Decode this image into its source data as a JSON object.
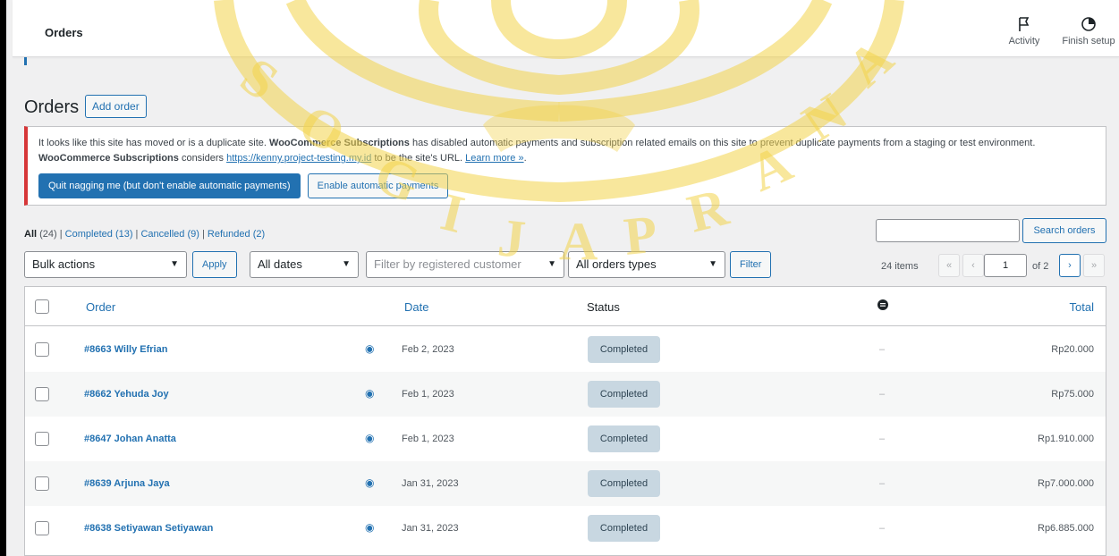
{
  "topbar": {
    "title": "Orders",
    "activity_label": "Activity",
    "activity_icon": "flag-icon",
    "finish_label": "Finish setup",
    "finish_icon": "progress-circle-icon"
  },
  "page": {
    "title": "Orders",
    "add_order_label": "Add order"
  },
  "notice": {
    "text_1": "It looks like this site has moved or is a duplicate site. ",
    "brand_1": "WooCommerce Subscriptions",
    "text_2": " has disabled automatic payments and subscription related emails on this site to prevent duplicate payments from a staging or test environment. ",
    "brand_2": "WooCommerce Subscriptions",
    "text_3": " considers ",
    "url": "https://kenny.project-testing.my.id",
    "text_4": " to be the site's URL. ",
    "learn_more": "Learn more »",
    "text_5": ".",
    "quit_button": "Quit nagging me (but don't enable automatic payments)",
    "enable_button": "Enable automatic payments"
  },
  "filters_nav": {
    "all_label": "All",
    "all_count": "(24)",
    "completed_label": "Completed",
    "completed_count": "(13)",
    "cancelled_label": "Cancelled",
    "cancelled_count": "(9)",
    "refunded_label": "Refunded",
    "refunded_count": "(2)",
    "separator": " | "
  },
  "search": {
    "value": "",
    "button": "Search orders"
  },
  "toolbar": {
    "bulk_actions": "Bulk actions",
    "apply": "Apply",
    "dates": "All dates",
    "customer_placeholder": "Filter by registered customer",
    "order_types": "All orders types",
    "filter": "Filter"
  },
  "pagination": {
    "items": "24 items",
    "first": "«",
    "prev": "‹",
    "current_page": "1",
    "of_total": "of 2",
    "next": "›",
    "last": "»"
  },
  "table": {
    "columns": {
      "order": "Order",
      "date": "Date",
      "status": "Status",
      "origin_icon": "comment-icon",
      "total": "Total"
    },
    "rows": [
      {
        "order": "#8663 Willy Efrian",
        "date": "Feb 2, 2023",
        "status": "Completed",
        "origin": "–",
        "total": "Rp20.000"
      },
      {
        "order": "#8662 Yehuda Joy",
        "date": "Feb 1, 2023",
        "status": "Completed",
        "origin": "–",
        "total": "Rp75.000"
      },
      {
        "order": "#8647 Johan Anatta",
        "date": "Feb 1, 2023",
        "status": "Completed",
        "origin": "–",
        "total": "Rp1.910.000"
      },
      {
        "order": "#8639 Arjuna Jaya",
        "date": "Jan 31, 2023",
        "status": "Completed",
        "origin": "–",
        "total": "Rp7.000.000"
      },
      {
        "order": "#8638 Setiyawan Setiyawan",
        "date": "Jan 31, 2023",
        "status": "Completed",
        "origin": "–",
        "total": "Rp6.885.000"
      }
    ]
  },
  "colors": {
    "accent": "#2271b1",
    "notice_border": "#d63638",
    "status_completed_bg": "#c8d7e1",
    "watermark": "#f3d34a"
  }
}
